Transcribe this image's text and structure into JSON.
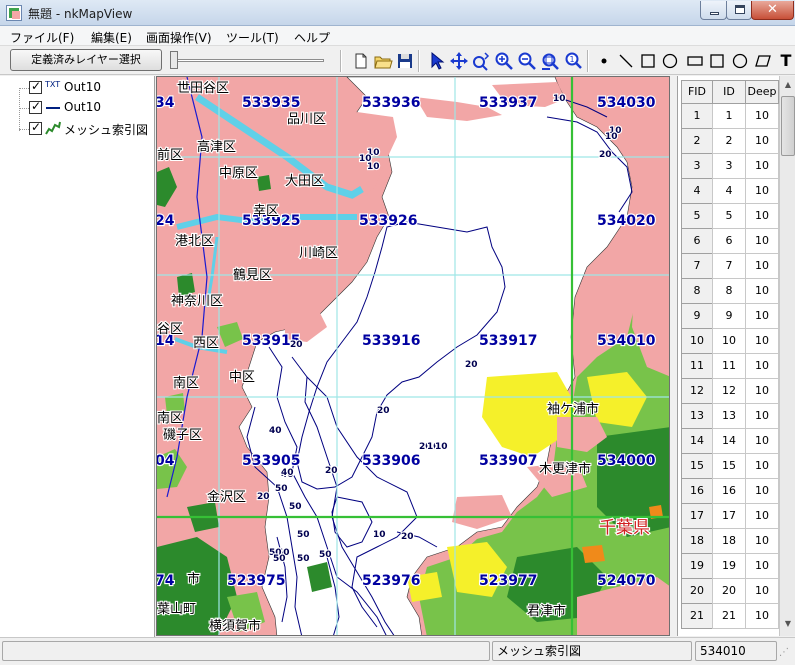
{
  "window": {
    "title": "無題 - nkMapView",
    "min_icon": "minimize-icon",
    "max_icon": "maximize-icon",
    "close_label": "✕"
  },
  "menubar": {
    "items": [
      {
        "label": "ファイル(F)"
      },
      {
        "label": "編集(E)"
      },
      {
        "label": "画面操作(V)"
      },
      {
        "label": "ツール(T)"
      },
      {
        "label": "ヘルプ"
      }
    ]
  },
  "toolbar": {
    "layer_select_label": "定義済みレイヤー選択",
    "slider_value": 0.0,
    "icons": [
      "new-file-icon",
      "open-folder-icon",
      "save-icon",
      "pointer-arrow-icon",
      "pan-move-icon",
      "zoom-pan-icon",
      "zoom-in-icon",
      "zoom-out-icon",
      "zoom-extent-icon",
      "zoom-previous-icon",
      "draw-point-icon",
      "draw-line-icon",
      "draw-rectangle-icon",
      "draw-circle-icon",
      "draw-round-rect-icon",
      "draw-ellipse-icon",
      "draw-polygon-icon",
      "draw-text-icon"
    ],
    "text_tool_label": "T"
  },
  "layers": [
    {
      "name": "Out10",
      "icon_text": "TXT",
      "checked": true
    },
    {
      "name": "Out10",
      "icon_text": "",
      "checked": true
    },
    {
      "name": "メッシュ索引図",
      "icon_text": "",
      "checked": true
    }
  ],
  "map": {
    "mesh_codes": [
      "533935",
      "533936",
      "533937",
      "534030",
      "533925",
      "533926",
      "534020",
      "533915",
      "533916",
      "533917",
      "534010",
      "533905",
      "533906",
      "533907",
      "534000",
      "523975",
      "523976",
      "523977",
      "524070"
    ],
    "mesh_fragments": [
      "34",
      "24",
      "14",
      "04",
      "74"
    ],
    "place_names": [
      "世田谷区",
      "品川区",
      "前区",
      "高津区",
      "中原区",
      "大田区",
      "幸区",
      "港北区",
      "川崎区",
      "鶴見区",
      "神奈川区",
      "谷区",
      "西区",
      "中区",
      "南区",
      "南区",
      "磯子区",
      "金沢区",
      "袖ケ浦市",
      "木更津市",
      "千葉県",
      "葉山町",
      "横須賀市",
      "君津市",
      "市"
    ],
    "depth_labels": [
      "10",
      "10",
      "10",
      "10",
      "20",
      "10",
      "10",
      "20",
      "20",
      "20",
      "20",
      "10",
      "10",
      "40",
      "40",
      "40",
      "20",
      "50",
      "50",
      "50",
      "50",
      "20",
      "50",
      "50",
      "50",
      "50",
      "20",
      "10"
    ],
    "colors": {
      "urban": "#f2a6a6",
      "forest_dark": "#2c8a2c",
      "forest_light": "#78c34a",
      "field": "#f5f02a",
      "orange": "#f08a1a",
      "water_line": "#000080",
      "mesh_line": "#9fe6e6",
      "mesh_major": "#36c036",
      "river": "#5fd0e8",
      "label": "#0000a0",
      "place": "#000000",
      "prefecture": "#d02020"
    }
  },
  "table": {
    "headers": [
      "FID",
      "ID",
      "Deep"
    ],
    "rows": [
      {
        "fid": "1",
        "id": "1",
        "deep": "10"
      },
      {
        "fid": "2",
        "id": "2",
        "deep": "10"
      },
      {
        "fid": "3",
        "id": "3",
        "deep": "10"
      },
      {
        "fid": "4",
        "id": "4",
        "deep": "10"
      },
      {
        "fid": "5",
        "id": "5",
        "deep": "10"
      },
      {
        "fid": "6",
        "id": "6",
        "deep": "10"
      },
      {
        "fid": "7",
        "id": "7",
        "deep": "10"
      },
      {
        "fid": "8",
        "id": "8",
        "deep": "10"
      },
      {
        "fid": "9",
        "id": "9",
        "deep": "10"
      },
      {
        "fid": "10",
        "id": "10",
        "deep": "10"
      },
      {
        "fid": "11",
        "id": "11",
        "deep": "10"
      },
      {
        "fid": "12",
        "id": "12",
        "deep": "10"
      },
      {
        "fid": "13",
        "id": "13",
        "deep": "10"
      },
      {
        "fid": "14",
        "id": "14",
        "deep": "10"
      },
      {
        "fid": "15",
        "id": "15",
        "deep": "10"
      },
      {
        "fid": "16",
        "id": "16",
        "deep": "10"
      },
      {
        "fid": "17",
        "id": "17",
        "deep": "10"
      },
      {
        "fid": "18",
        "id": "18",
        "deep": "10"
      },
      {
        "fid": "19",
        "id": "19",
        "deep": "10"
      },
      {
        "fid": "20",
        "id": "20",
        "deep": "10"
      },
      {
        "fid": "21",
        "id": "21",
        "deep": "10"
      }
    ]
  },
  "statusbar": {
    "panel1": "",
    "panel2": "メッシュ索引図",
    "panel3": "534010"
  }
}
